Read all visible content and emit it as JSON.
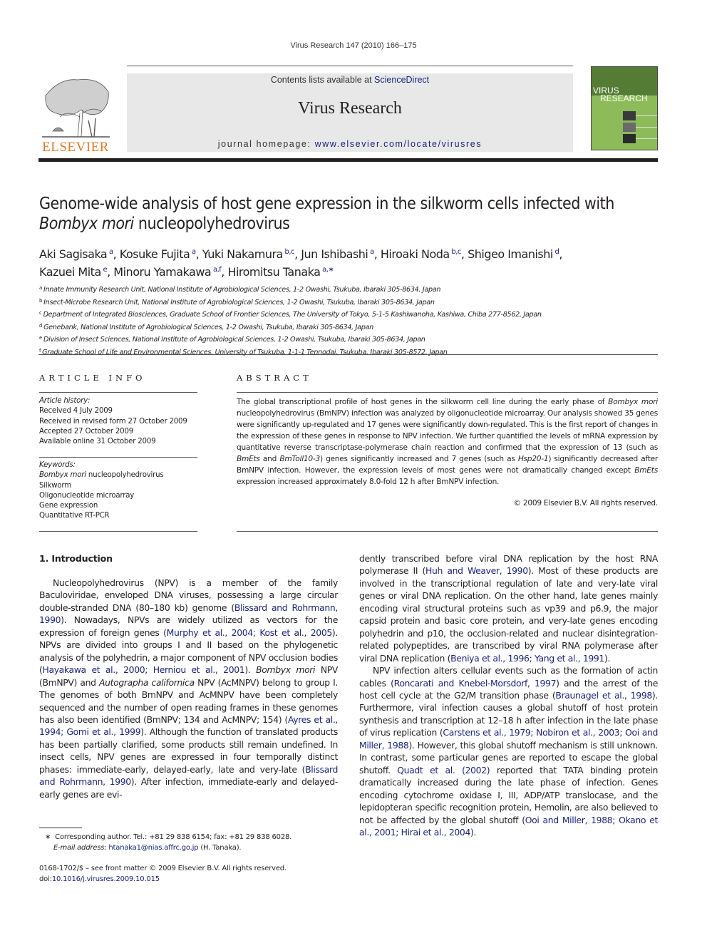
{
  "running_head": "Virus Research 147 (2010) 166–175",
  "masthead": {
    "publisher_logo_text": "ELSEVIER",
    "contents_prefix": "Contents lists available at ",
    "contents_link": "ScienceDirect",
    "journal_name": "Virus Research",
    "homepage_prefix": "journal homepage: ",
    "homepage_link": "www.elsevier.com/locate/virusres",
    "cover_title_line1": "VIRUS",
    "cover_title_line2": "RESEARCH",
    "colors": {
      "elsevier_orange": "#e87722",
      "cover_dark_green": "#557c34",
      "cover_light_green": "#8dbb5a",
      "link_blue": "#1a237e"
    }
  },
  "article": {
    "title_part1": "Genome-wide analysis of host gene expression in the silkworm cells infected with ",
    "title_italic": "Bombyx mori",
    "title_part2": " nucleopolyhedrovirus",
    "authors": [
      {
        "name": "Aki Sagisaka",
        "sup": "a"
      },
      {
        "name": "Kosuke Fujita",
        "sup": "a"
      },
      {
        "name": "Yuki Nakamura",
        "sup": "b,c"
      },
      {
        "name": "Jun Ishibashi",
        "sup": "a"
      },
      {
        "name": "Hiroaki Noda",
        "sup": "b,c"
      },
      {
        "name": "Shigeo Imanishi",
        "sup": "d"
      },
      {
        "name": "Kazuei Mita",
        "sup": "e"
      },
      {
        "name": "Minoru Yamakawa",
        "sup": "a,f"
      },
      {
        "name": "Hiromitsu Tanaka",
        "sup": "a,∗"
      }
    ],
    "affiliations": [
      {
        "key": "a",
        "text": "Innate Immunity Research Unit, National Institute of Agrobiological Sciences, 1-2 Owashi, Tsukuba, Ibaraki 305-8634, Japan"
      },
      {
        "key": "b",
        "text": "Insect-Microbe Research Unit, National Institute of Agrobiological Sciences, 1-2 Owashi, Tsukuba, Ibaraki 305-8634, Japan"
      },
      {
        "key": "c",
        "text": "Department of Integrated Biosciences, Graduate School of Frontier Sciences, The University of Tokyo, 5-1-5 Kashiwanoha, Kashiwa, Chiba 277-8562, Japan"
      },
      {
        "key": "d",
        "text": "Genebank, National Institute of Agrobiological Sciences, 1-2 Owashi, Tsukuba, Ibaraki 305-8634, Japan"
      },
      {
        "key": "e",
        "text": "Division of Insect Sciences, National Institute of Agrobiological Sciences, 1-2 Owashi, Tsukuba, Ibaraki 305-8634, Japan"
      },
      {
        "key": "f",
        "text": "Graduate School of Life and Environmental Sciences, University of Tsukuba, 1-1-1 Tennodai, Tsukuba, Ibaraki 305-8572, Japan"
      }
    ]
  },
  "article_info": {
    "heading": "ARTICLE INFO",
    "history_label": "Article history:",
    "history": [
      "Received 4 July 2009",
      "Received in revised form 27 October 2009",
      "Accepted 27 October 2009",
      "Available online 31 October 2009"
    ],
    "keywords_label": "Keywords:",
    "keyword_first_italic": "Bombyx mori",
    "keyword_first_rest": " nucleopolyhedrovirus",
    "keywords": [
      "Silkworm",
      "Oligonucleotide microarray",
      "Gene expression",
      "Quantitative RT-PCR"
    ]
  },
  "abstract": {
    "heading": "ABSTRACT",
    "segments": [
      {
        "t": "The global transcriptional profile of host genes in the silkworm cell line during the early phase of "
      },
      {
        "t": "Bombyx mori",
        "i": true
      },
      {
        "t": " nucleopolyhedrovirus (BmNPV) infection was analyzed by oligonucleotide microarray. Our analysis showed 35 genes were significantly up-regulated and 17 genes were significantly down-regulated. This is the first report of changes in the expression of these genes in response to NPV infection. We further quantified the levels of mRNA expression by quantitative reverse transcriptase-polymerase chain reaction and confirmed that the expression of 13 (such as "
      },
      {
        "t": "BmEts",
        "i": true
      },
      {
        "t": " and "
      },
      {
        "t": "BmToll10-3",
        "i": true
      },
      {
        "t": ") genes significantly increased and 7 genes (such as "
      },
      {
        "t": "Hsp20-1",
        "i": true
      },
      {
        "t": ") significantly decreased after BmNPV infection. However, the expression levels of most genes were not dramatically changed except "
      },
      {
        "t": "BmEts",
        "i": true
      },
      {
        "t": " expression increased approximately 8.0-fold 12 h after BmNPV infection."
      }
    ],
    "copyright": "© 2009 Elsevier B.V. All rights reserved."
  },
  "introduction": {
    "heading": "1.  Introduction",
    "left_column": [
      {
        "t": "Nucleopolyhedrovirus (NPV) is a member of the family Baculoviridae, enveloped DNA viruses, possessing a large circular double-stranded DNA (80–180 kb) genome ("
      },
      {
        "t": "Blissard and Rohrmann, 1990",
        "link": true
      },
      {
        "t": "). Nowadays, NPVs are widely utilized as vectors for the expression of foreign genes ("
      },
      {
        "t": "Murphy et al., 2004; Kost et al., 2005",
        "link": true
      },
      {
        "t": "). NPVs are divided into groups I and II based on the phylogenetic analysis of the polyhedrin, a major component of NPV occlusion bodies ("
      },
      {
        "t": "Hayakawa et al., 2000; Herniou et al., 2001",
        "link": true
      },
      {
        "t": "). "
      },
      {
        "t": "Bombyx mori",
        "i": true
      },
      {
        "t": " NPV (BmNPV) and "
      },
      {
        "t": "Autographa californica",
        "i": true
      },
      {
        "t": " NPV (AcMNPV) belong to group I. The genomes of both BmNPV and AcMNPV have been completely sequenced and the number of open reading frames in these genomes has also been identified (BmNPV; 134 and AcMNPV; 154) ("
      },
      {
        "t": "Ayres et al., 1994; Gomi et al., 1999",
        "link": true
      },
      {
        "t": "). Although the function of translated products has been partially clarified, some products still remain undefined. In insect cells, NPV genes are expressed in four temporally distinct phases: immediate-early, delayed-early, late and very-late ("
      },
      {
        "t": "Blissard and Rohrmann, 1990",
        "link": true
      },
      {
        "t": "). After infection, immediate-early and delayed-early genes are evi-"
      }
    ],
    "right_column_p1": [
      {
        "t": "dently transcribed before viral DNA replication by the host RNA polymerase II ("
      },
      {
        "t": "Huh and Weaver, 1990",
        "link": true
      },
      {
        "t": "). Most of these products are involved in the transcriptional regulation of late and very-late viral genes or viral DNA replication. On the other hand, late genes mainly encoding viral structural proteins such as vp39 and p6.9, the major capsid protein and basic core protein, and very-late genes encoding polyhedrin and p10, the occlusion-related and nuclear disintegration-related polypeptides, are transcribed by viral RNA polymerase after viral DNA replication ("
      },
      {
        "t": "Beniya et al., 1996; Yang et al., 1991",
        "link": true
      },
      {
        "t": ")."
      }
    ],
    "right_column_p2": [
      {
        "t": "NPV infection alters cellular events such as the formation of actin cables ("
      },
      {
        "t": "Roncarati and Knebel-Morsdorf, 1997",
        "link": true
      },
      {
        "t": ") and the arrest of the host cell cycle at the G2/M transition phase ("
      },
      {
        "t": "Braunagel et al., 1998",
        "link": true
      },
      {
        "t": "). Furthermore, viral infection causes a global shutoff of host protein synthesis and transcription at 12–18 h after infection in the late phase of virus replication ("
      },
      {
        "t": "Carstens et al., 1979; Nobiron et al., 2003; Ooi and Miller, 1988",
        "link": true
      },
      {
        "t": "). However, this global shutoff mechanism is still unknown. In contrast, some particular genes are reported to escape the global shutoff. "
      },
      {
        "t": "Quadt et al. (2002)",
        "link": true
      },
      {
        "t": " reported that TATA binding protein dramatically increased during the late phase of infection. Genes encoding cytochrome oxidase I, III, ADP/ATP translocase, and the lepidopteran specific recognition protein, Hemolin, are also believed to not be affected by the global shutoff ("
      },
      {
        "t": "Ooi and Miller, 1988; Okano et al., 2001; Hirai et al., 2004",
        "link": true
      },
      {
        "t": ")."
      }
    ]
  },
  "footnotes": {
    "corresponding_marker": "∗",
    "corresponding_text": "Corresponding author. Tel.: +81 29 838 6154; fax: +81 29 838 6028.",
    "email_label": "E-mail address:",
    "email": "htanaka1@nias.affrc.go.jp",
    "email_suffix": " (H. Tanaka).",
    "front_matter": "0168-1702/$ – see front matter © 2009 Elsevier B.V. All rights reserved.",
    "doi_prefix": "doi:",
    "doi": "10.1016/j.virusres.2009.10.015"
  }
}
